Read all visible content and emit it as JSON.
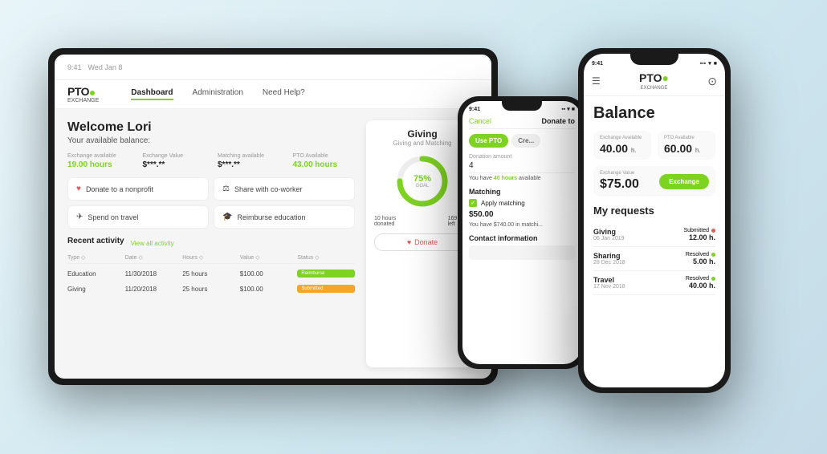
{
  "app": {
    "name": "PTO Exchange"
  },
  "tablet": {
    "status_time": "9:41",
    "status_date": "Wed Jan 8",
    "nav": {
      "logo_pto": "PTO",
      "logo_exchange": "EXCHANGE",
      "items": [
        {
          "label": "Dashboard",
          "active": true
        },
        {
          "label": "Administration",
          "active": false
        },
        {
          "label": "Need Help?",
          "active": false
        }
      ]
    },
    "welcome": {
      "title": "Welcome Lori",
      "subtitle": "Your available balance:"
    },
    "balance": [
      {
        "label": "Exchange available",
        "value": "19.00 hours",
        "type": "green"
      },
      {
        "label": "Exchange Value",
        "value": "$***.**",
        "type": "dark"
      },
      {
        "label": "Matching available",
        "value": "$***.**",
        "type": "dark"
      },
      {
        "label": "PTO Available",
        "value": "43.00 hours",
        "type": "green"
      }
    ],
    "actions": [
      {
        "icon": "♥",
        "label": "Donate to a nonprofit"
      },
      {
        "icon": "⚖",
        "label": "Share with co-worker"
      },
      {
        "icon": "✈",
        "label": "Spend on travel"
      },
      {
        "icon": "🎓",
        "label": "Reimburse education"
      }
    ],
    "recent_activity": {
      "title": "Recent activity",
      "link": "View all activity",
      "headers": [
        "Type ◇",
        "Date ◇",
        "Hours ◇",
        "Value ◇",
        "Status ◇"
      ],
      "rows": [
        {
          "type": "Education",
          "date": "11/30/2018",
          "hours": "25 hours",
          "value": "$100.00",
          "status": "Reimburse",
          "status_type": "green"
        },
        {
          "type": "Giving",
          "date": "11/20/2018",
          "hours": "25 hours",
          "value": "$100.00",
          "status": "Submitted",
          "status_type": "orange"
        }
      ]
    },
    "giving_card": {
      "title": "Giving",
      "subtitle": "Giving and Matching",
      "percentage": 75,
      "goal_label": "GOAL",
      "hours_donated": "10 hours donated",
      "days_left": "169 days left",
      "donate_btn": "Donate"
    }
  },
  "phone_mid": {
    "status_time": "9:41",
    "header": {
      "cancel": "Cancel",
      "title": "Donate to"
    },
    "tabs": [
      {
        "label": "Use PTO",
        "active": true
      },
      {
        "label": "Cre...",
        "active": false
      }
    ],
    "donation_amount_label": "Donation amount",
    "donation_amount_value": "4",
    "available_text": "You have",
    "available_hours": "40 hours",
    "available_suffix": "available",
    "matching": {
      "title": "Matching",
      "apply_label": "Apply matching",
      "amount": "$50.00",
      "available_text": "You have $740.00 in matchi..."
    },
    "contact": {
      "title": "Contact information"
    }
  },
  "phone_right": {
    "status_time": "9:41",
    "status_icons": "▪▪▪ ▾ ■",
    "balance": {
      "title": "Balance",
      "exchange_available_label": "Exchange Available",
      "exchange_available_value": "40.00",
      "exchange_available_unit": "h.",
      "pto_available_label": "PTO Available",
      "pto_available_value": "60.00",
      "pto_available_unit": "h.",
      "exchange_value_label": "Exchange Value",
      "exchange_value_amount": "$75.00",
      "exchange_btn": "Exchange"
    },
    "requests": {
      "title": "My requests",
      "items": [
        {
          "type": "Giving",
          "date": "06 Jan 2019",
          "status": "Submitted",
          "status_type": "red",
          "hours": "12.00 h."
        },
        {
          "type": "Sharing",
          "date": "28 Dec 2018",
          "status": "Resolved",
          "status_type": "green",
          "hours": "5.00 h."
        },
        {
          "type": "Travel",
          "date": "17 Nov 2018",
          "status": "Resolved",
          "status_type": "green",
          "hours": "40.00 h."
        }
      ]
    }
  }
}
